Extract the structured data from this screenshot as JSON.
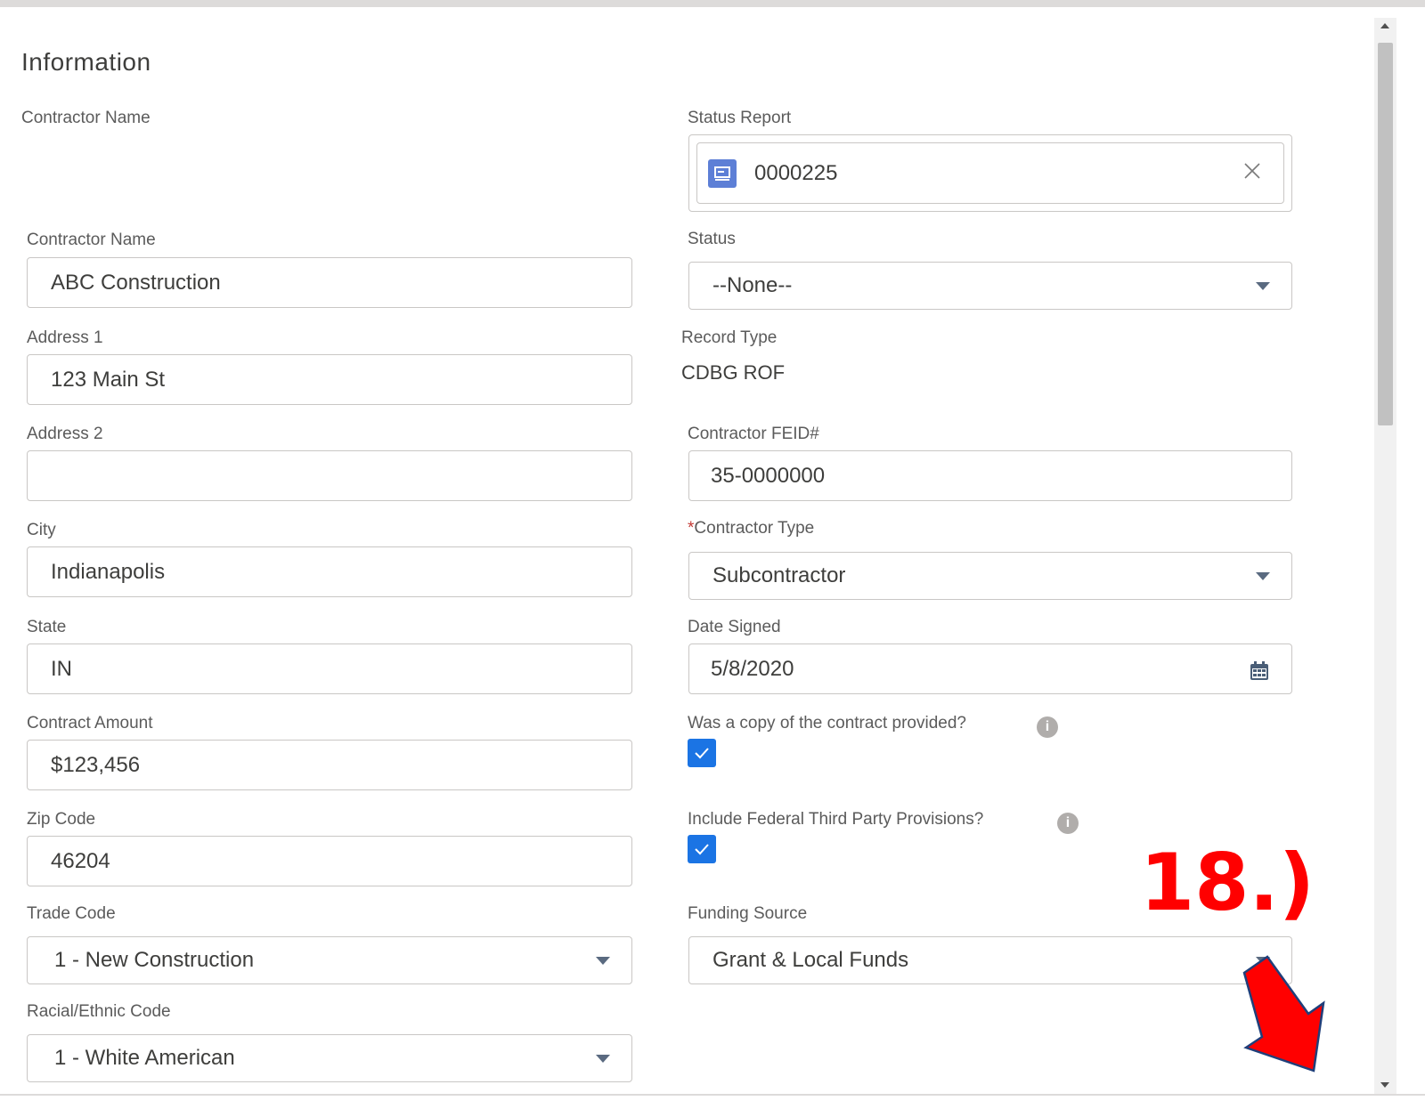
{
  "section": {
    "title": "Information"
  },
  "left": {
    "contractor_name_static_label": "Contractor Name",
    "contractor_name_label": "Contractor Name",
    "contractor_name_value": "ABC Construction",
    "address1_label": "Address 1",
    "address1_value": "123 Main St",
    "address2_label": "Address 2",
    "address2_value": "",
    "city_label": "City",
    "city_value": "Indianapolis",
    "state_label": "State",
    "state_value": "IN",
    "contract_amount_label": "Contract Amount",
    "contract_amount_value": "$123,456",
    "zip_label": "Zip Code",
    "zip_value": "46204",
    "trade_code_label": "Trade Code",
    "trade_code_value": "1 - New Construction",
    "racial_label": "Racial/Ethnic Code",
    "racial_value": "1 - White American"
  },
  "right": {
    "status_report_label": "Status Report",
    "status_report_value": "0000225",
    "status_label": "Status",
    "status_value": "--None--",
    "record_type_label": "Record Type",
    "record_type_value": "CDBG ROF",
    "feid_label": "Contractor FEID#",
    "feid_value": "35-0000000",
    "contractor_type_required": "*",
    "contractor_type_label": "Contractor Type",
    "contractor_type_value": "Subcontractor",
    "date_signed_label": "Date Signed",
    "date_signed_value": "5/8/2020",
    "copy_provided_label": "Was a copy of the contract provided?",
    "copy_provided_checked": true,
    "federal_label": "Include Federal Third Party Provisions?",
    "federal_checked": true,
    "funding_label": "Funding Source",
    "funding_value": "Grant & Local Funds"
  },
  "annotation": {
    "step_label": "18.)",
    "color": "#ff0000"
  },
  "colors": {
    "accent": "#1b74e4",
    "border": "#c9c7c5",
    "lookup_icon": "#5d7fd6"
  },
  "icons": [
    "record-lookup-icon",
    "clear-icon",
    "caret-down-icon",
    "calendar-icon",
    "info-icon",
    "check-icon",
    "arrow-icon"
  ]
}
